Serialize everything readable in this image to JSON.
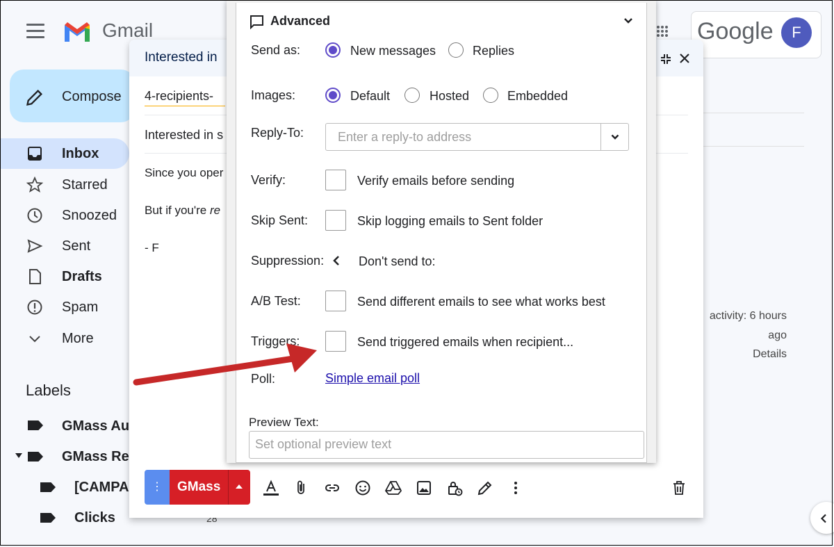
{
  "gmail": {
    "brand": "Gmail",
    "compose_label": "Compose",
    "nav": [
      {
        "label": "Inbox",
        "bold": true
      },
      {
        "label": "Starred"
      },
      {
        "label": "Snoozed"
      },
      {
        "label": "Sent"
      },
      {
        "label": "Drafts",
        "bold": true
      },
      {
        "label": "Spam"
      },
      {
        "label": "More"
      }
    ],
    "labels_heading": "Labels",
    "labels": [
      {
        "label": "GMass Aut"
      },
      {
        "label": "GMass Rep"
      },
      {
        "label": "[CAMPA"
      },
      {
        "label": "Clicks",
        "count": "28"
      }
    ],
    "google_logo": "Google",
    "avatar_initial": "F",
    "activity_line1": "activity: 6 hours",
    "activity_line2": "ago",
    "details_link": "Details"
  },
  "compose": {
    "window_title": "Interested in",
    "to_chip": "4-recipients-",
    "subject": "Interested in s",
    "body_line1": "Since you oper",
    "body_line2_prefix": "But if you're ",
    "body_line2_italic": "re",
    "body_line3": "- F",
    "gmass_button": "GMass",
    "options_button": "⋮",
    "icons": [
      "format-text-icon",
      "attach-icon",
      "link-icon",
      "emoji-icon",
      "drive-icon",
      "photo-icon",
      "confidential-icon",
      "signature-icon",
      "more-options-icon",
      "delete-icon"
    ]
  },
  "advanced": {
    "title": "Advanced",
    "send_as": {
      "label": "Send as:",
      "options": [
        "New messages",
        "Replies"
      ],
      "selected": "New messages"
    },
    "images": {
      "label": "Images:",
      "options": [
        "Default",
        "Hosted",
        "Embedded"
      ],
      "selected": "Default"
    },
    "reply_to": {
      "label": "Reply-To:",
      "placeholder": "Enter a reply-to address"
    },
    "verify": {
      "label": "Verify:",
      "text": "Verify emails before sending",
      "checked": false
    },
    "skip_sent": {
      "label": "Skip Sent:",
      "text": "Skip logging emails to Sent folder",
      "checked": false
    },
    "suppression": {
      "label": "Suppression:",
      "text": "Don't send to:"
    },
    "ab_test": {
      "label": "A/B Test:",
      "text": "Send different emails to see what works best",
      "checked": false
    },
    "triggers": {
      "label": "Triggers:",
      "text": "Send triggered emails when recipient...",
      "checked": false
    },
    "poll": {
      "label": "Poll:",
      "link": "Simple email poll"
    },
    "preview_text": {
      "label": "Preview Text:",
      "placeholder": "Set optional preview text"
    }
  },
  "colors": {
    "accent_radio": "#5f4bc9",
    "gmass_red": "#d61f26",
    "annotation_arrow": "#d32f2f",
    "link_blue": "#1a0dab"
  }
}
